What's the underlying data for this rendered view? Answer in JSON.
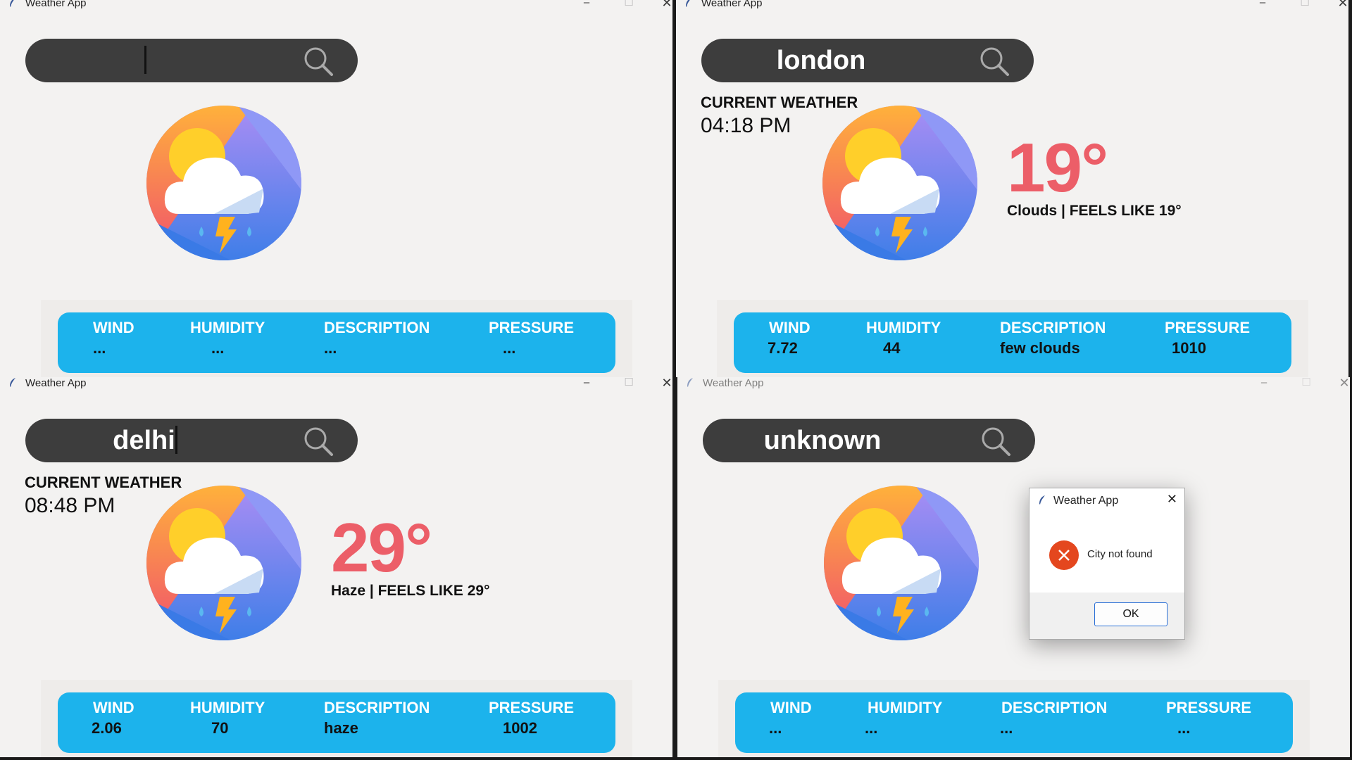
{
  "window_title": "Weather App",
  "titlebar": {
    "minimize": "–",
    "maximize": "☐",
    "close": "✕"
  },
  "stat_labels": {
    "wind": "WIND",
    "humidity": "HUMIDITY",
    "description": "DESCRIPTION",
    "pressure": "PRESSURE"
  },
  "current_weather_label": "CURRENT WEATHER",
  "windows": [
    {
      "search": "",
      "time": "",
      "temp": "",
      "condition": "",
      "wind": "...",
      "humidity": "...",
      "description": "...",
      "pressure": "..."
    },
    {
      "search": "london",
      "time": "04:18 PM",
      "temp": "19°",
      "condition": "Clouds | FEELS LIKE 19°",
      "wind": "7.72",
      "humidity": "44",
      "description": "few clouds",
      "pressure": "1010"
    },
    {
      "search": "delhi",
      "time": "08:48 PM",
      "temp": "29°",
      "condition": "Haze | FEELS LIKE 29°",
      "wind": "2.06",
      "humidity": "70",
      "description": "haze",
      "pressure": "1002"
    },
    {
      "search": "unknown",
      "time": "",
      "temp": "",
      "condition": "",
      "wind": "...",
      "humidity": "...",
      "description": "...",
      "pressure": "..."
    }
  ],
  "dialog": {
    "title": "Weather App",
    "message": "City not found",
    "ok_label": "OK",
    "close": "✕"
  },
  "colors": {
    "accent": "#1cb3ec",
    "temp": "#ec5e68",
    "search_bar": "#3d3d3d",
    "background": "#f3f2f1",
    "error": "#e4471e"
  },
  "icons": [
    "feather-icon",
    "search-icon",
    "weather-logo-icon",
    "error-icon"
  ]
}
